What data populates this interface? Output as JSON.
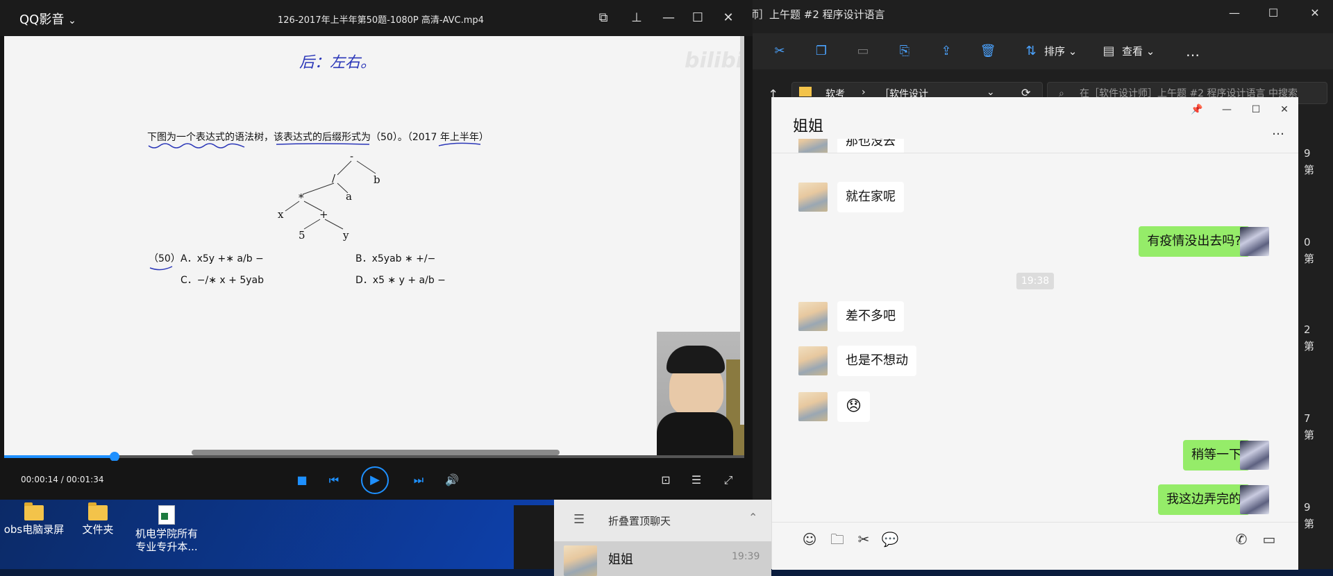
{
  "player": {
    "app_name": "QQ影音",
    "app_menu_caret": "⌄",
    "filename": "126-2017年上半年第50题-1080P 高清-AVC.mp4",
    "watermark": "bilibili",
    "video": {
      "handwritten_note": "后：左右。",
      "question": "下图为一个表达式的语法树，该表达式的后缀形式为（50）。（2017 年上半年）",
      "tree": {
        "root": "-",
        "l1_left": "/",
        "l1_right": "b",
        "l2_left": "*",
        "l2_right": "a",
        "l3_left": "x",
        "l3_right": "+",
        "l4_left": "5",
        "l4_right": "y"
      },
      "options": {
        "label": "（50）",
        "a": "A．x5y +∗ a/b −",
        "b": "B．x5yab ∗ +/−",
        "c": "C．−/∗ x + 5yab",
        "d": "D．x5 ∗ y + a/b −"
      }
    },
    "progress": {
      "current": "00:00:14",
      "total": "00:01:34",
      "fraction": 0.149,
      "time_display": "00:00:14 / 00:01:34"
    }
  },
  "explorer": {
    "title": "师］上午题 #2 程序设计语言",
    "toolbar": {
      "sort_label": "排序",
      "view_label": "查看",
      "more": "…"
    },
    "address": {
      "seg1": "软考",
      "seg2": "［软件设计"
    },
    "search_placeholder": "在［软件设计师］上午题 #2 程序设计语言 中搜索",
    "right_fragments": [
      "9",
      "第",
      "0",
      "第",
      "2",
      "第",
      "7",
      "第",
      "9",
      "第"
    ]
  },
  "desktop": {
    "icons": [
      {
        "label": "obs电脑录屏"
      },
      {
        "label": "文件夹"
      },
      {
        "label": "机电学院所有专业专升本..."
      }
    ]
  },
  "chatlist": {
    "fold_label": "折叠置顶聊天",
    "contact": "姐姐",
    "contact_time": "19:39"
  },
  "chat": {
    "title": "姐姐",
    "messages": [
      {
        "side": "left",
        "text": "就在家呢"
      },
      {
        "side": "right",
        "text": "有疫情没出去吗?"
      },
      {
        "side": "left",
        "text": "差不多吧"
      },
      {
        "side": "left",
        "text": "也是不想动"
      },
      {
        "side": "left",
        "text": "😞"
      },
      {
        "side": "right",
        "text": "稍等一下"
      },
      {
        "side": "right",
        "text": "我这边弄完的"
      }
    ],
    "partial_top_text": "那也没去",
    "timestamp": "19:38",
    "more": "…"
  },
  "colors": {
    "accent_blue": "#1e90ff",
    "wechat_green": "#95ec69"
  }
}
